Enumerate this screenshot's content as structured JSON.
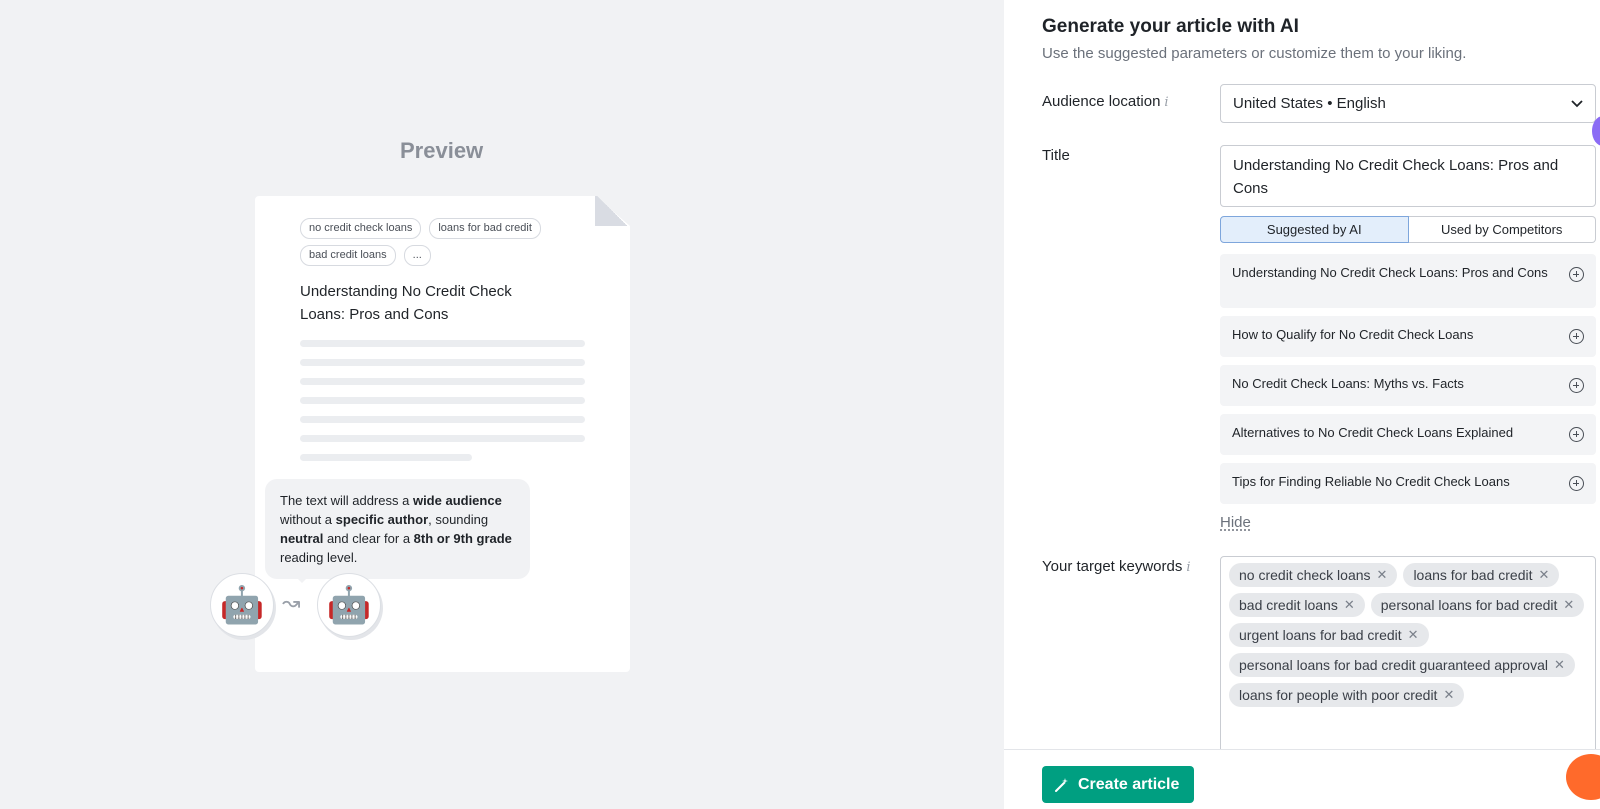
{
  "preview": {
    "title": "Preview",
    "chips": [
      "no credit check loans",
      "loans for bad credit",
      "bad credit loans",
      "..."
    ],
    "heading": "Understanding No Credit Check Loans: Pros and Cons",
    "bubble": {
      "t1": "The text will address a ",
      "b1": "wide audience",
      "t2": " without a ",
      "b2": "specific author",
      "t3": ", sounding ",
      "b3": "neutral",
      "t4": " and clear for a ",
      "b4": "8th or 9th grade",
      "t5": " reading level."
    },
    "robot_emoji": "🤖"
  },
  "panel": {
    "title": "Generate your article with AI",
    "subtitle": "Use the suggested parameters or customize them to your liking.",
    "audience_label": "Audience location",
    "audience_value": "United States • English",
    "title_label": "Title",
    "title_value": "Understanding No Credit Check Loans: Pros and Cons",
    "tabs": [
      "Suggested by AI",
      "Used by Competitors"
    ],
    "suggestions": [
      "Understanding No Credit Check Loans: Pros and Cons",
      "How to Qualify for No Credit Check Loans",
      "No Credit Check Loans: Myths vs. Facts",
      "Alternatives to No Credit Check Loans Explained",
      "Tips for Finding Reliable No Credit Check Loans"
    ],
    "hide_label": "Hide",
    "keywords_label": "Your target keywords",
    "keywords": [
      "no credit check loans",
      "loans for bad credit",
      "bad credit loans",
      "personal loans for bad credit",
      "urgent loans for bad credit",
      "personal loans for bad credit guaranteed approval",
      "loans for people with poor credit"
    ],
    "create_label": "Create article"
  },
  "colors": {
    "accent": "#009f81",
    "tab_active": "#e3eefb",
    "chat": "#ff6a2b",
    "scroll": "#8b6cf5"
  }
}
